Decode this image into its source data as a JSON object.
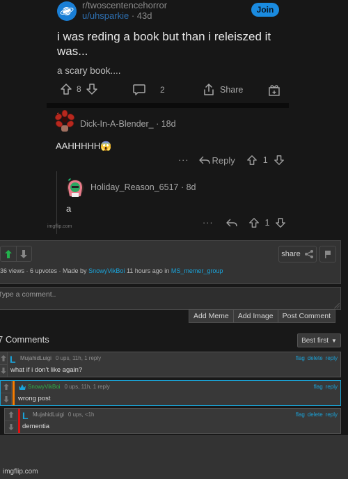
{
  "reddit": {
    "subreddit": "r/twoscentencehorror",
    "author": "u/uhsparkie",
    "age": "· 43d",
    "join_label": "Join",
    "title": "i was reding a book but than i releiszed it was...",
    "body": "a scary book....",
    "upvotes": "8",
    "comments_count": "2",
    "share_label": "Share",
    "comments": [
      {
        "user": "Dick-In-A-Blender_",
        "age": "· 18d",
        "text": "AAHHHHH😱",
        "more": "···",
        "reply_label": "Reply",
        "score": "1"
      },
      {
        "user": "Holiday_Reason_6517",
        "age": "· 8d",
        "text": "a",
        "more": "···",
        "score": "1"
      }
    ],
    "watermark": "imgflip.com"
  },
  "imgflip": {
    "share_label": "share",
    "meta": {
      "stats": "36 views · 6 upvotes · Made by ",
      "author": "SnowyVikBoi",
      "time": " 11 hours ago in ",
      "group": "MS_memer_group"
    },
    "comment_placeholder": "Type a comment..",
    "buttons": {
      "add_meme": "Add Meme",
      "add_image": "Add Image",
      "post_comment": "Post Comment"
    },
    "comments_title": "7 Comments",
    "sort_label": "Best first",
    "comments": [
      {
        "user": "MujahidLuigi",
        "info": "0 ups, 11h, 1 reply",
        "text": "what if i don't like again?",
        "links": [
          "flag",
          "delete",
          "reply"
        ],
        "stripe_color": "",
        "user_color": "#999999"
      },
      {
        "user": "SnowyVikBoi",
        "info": "0 ups, 11h, 1 reply",
        "text": "wrong post",
        "links": [
          "flag",
          "reply"
        ],
        "stripe_color": "#f57c00",
        "user_color": "#2fae48"
      },
      {
        "user": "MujahidLuigi",
        "info": "0 ups, <1h",
        "text": "dementia",
        "links": [
          "flag",
          "delete",
          "reply"
        ],
        "stripe_color": "#e01010",
        "user_color": "#999999"
      }
    ],
    "watermark": "imgflip.com"
  },
  "colors": {
    "link": "#1aa3d9",
    "upvote_active": "#22b24c",
    "reddit_blue": "#1a8be0"
  }
}
